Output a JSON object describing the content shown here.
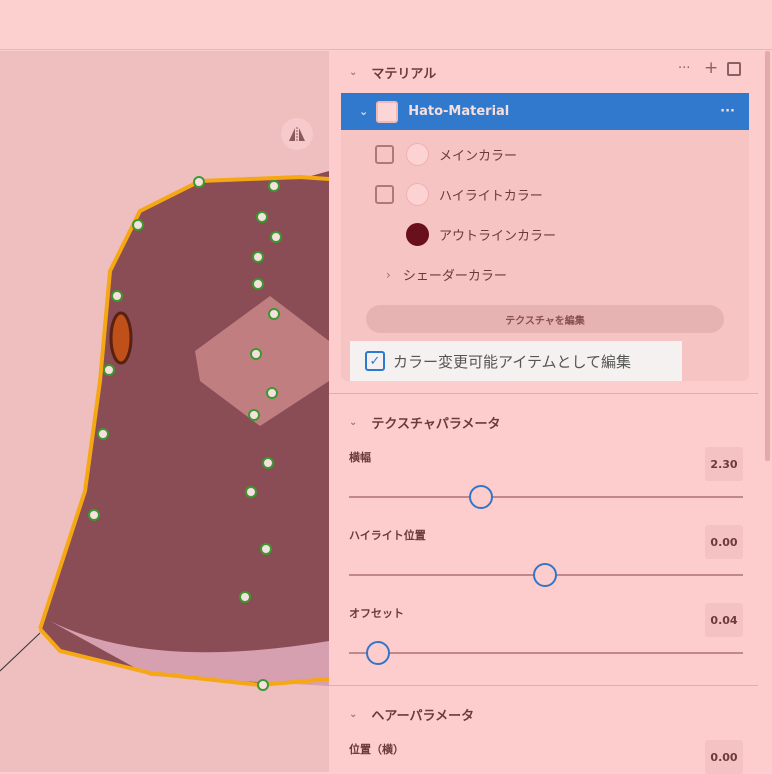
{
  "viewport": {
    "mirror_icon": "mirror-icon"
  },
  "material": {
    "title": "マテリアル",
    "name": "Hato-Material",
    "items": [
      {
        "label": "メインカラー",
        "checked": false,
        "color": "#fdd2d2"
      },
      {
        "label": "ハイライトカラー",
        "checked": false,
        "color": "#fdd2d2"
      },
      {
        "label": "アウトラインカラー",
        "color": "#6a0f1c"
      }
    ],
    "shader": "シェーダーカラー",
    "edit_texture": "テクスチャを編集",
    "color_edit_checkbox": "カラー変更可能アイテムとして編集",
    "color_edit_checked": true
  },
  "texture_params": {
    "title": "テクスチャパラメータ",
    "params": [
      {
        "label": "横幅",
        "value": "2.30",
        "fraction": 0.335
      },
      {
        "label": "ハイライト位置",
        "value": "0.00",
        "fraction": 0.497
      },
      {
        "label": "オフセット",
        "value": "0.04",
        "fraction": 0.074
      }
    ]
  },
  "hair_params": {
    "title": "ヘアーパラメータ",
    "params": [
      {
        "label": "位置（横）",
        "value": "0.00"
      }
    ]
  },
  "colors": {
    "accent": "#3079cc",
    "outline": "#6a0f1c"
  }
}
